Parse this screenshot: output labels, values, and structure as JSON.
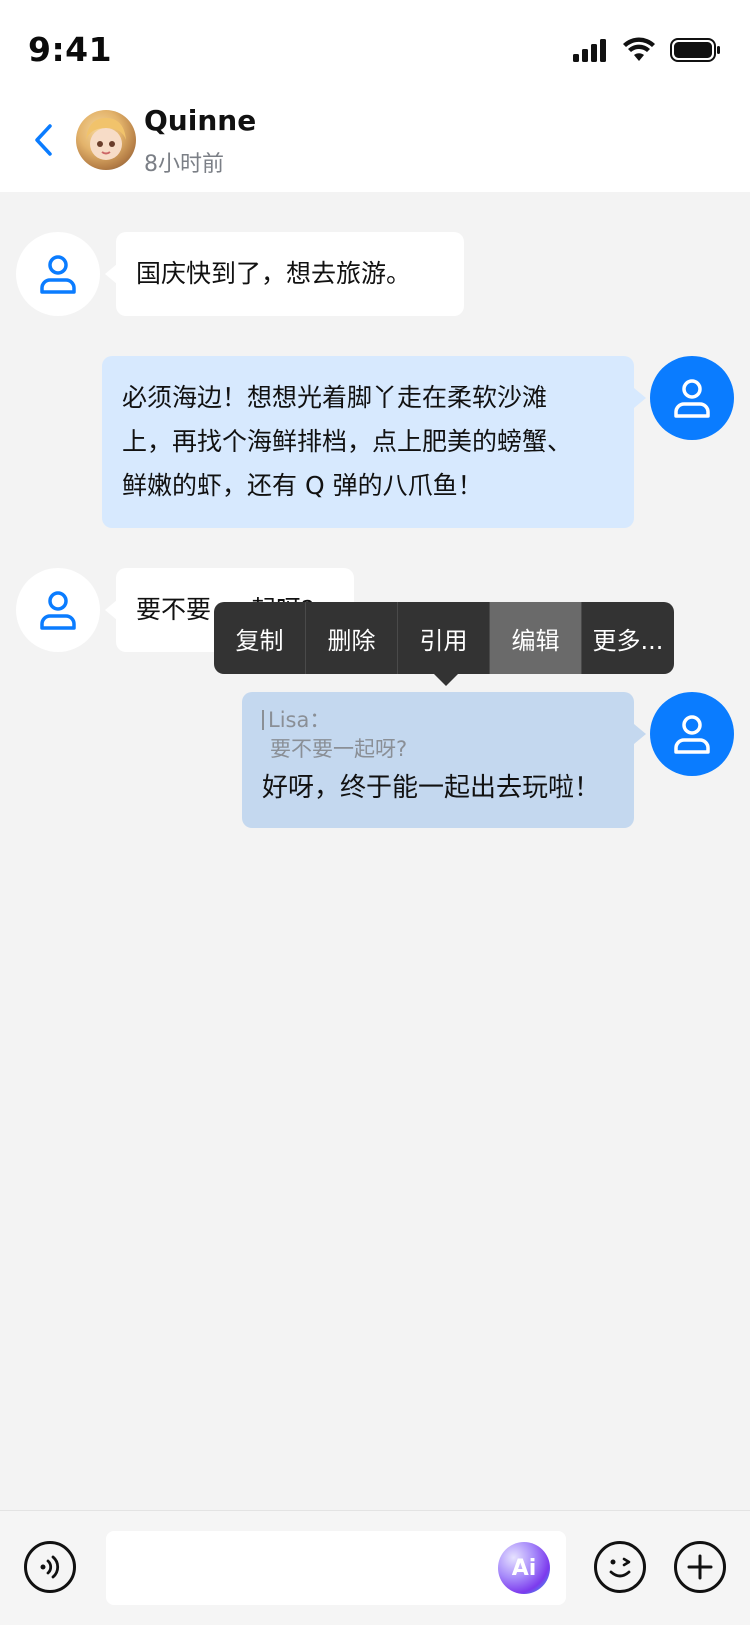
{
  "status_bar": {
    "time": "9:41",
    "icons": [
      "signal-icon",
      "wifi-icon",
      "battery-icon"
    ]
  },
  "header": {
    "name": "Quinne",
    "last_seen": "8小时前"
  },
  "messages": [
    {
      "side": "left",
      "text": "国庆快到了，想去旅游。"
    },
    {
      "side": "right",
      "lines": [
        "必须海边！想想光着脚丫走在柔软沙滩",
        "上，再找个海鲜排档，点上肥美的螃蟹、",
        "鲜嫩的虾，还有 Q 弹的八爪鱼！"
      ]
    },
    {
      "side": "left",
      "text_visible": "要不要",
      "text_tail": "起呀?"
    },
    {
      "side": "right",
      "quote_name": "Lisa：",
      "quote_text": "要不要一起呀?",
      "text": "好呀，终于能一起出去玩啦！"
    }
  ],
  "context_menu": {
    "items": [
      "复制",
      "删除",
      "引用",
      "编辑",
      "更多..."
    ],
    "active_index": 3
  },
  "input": {
    "placeholder": "",
    "ai_label": "Ai"
  },
  "colors": {
    "accent": "#0a7cff",
    "bubble_right": "#d7e9fe",
    "bubble_right_selected": "#c4d8ef",
    "background": "#f3f3f3"
  }
}
